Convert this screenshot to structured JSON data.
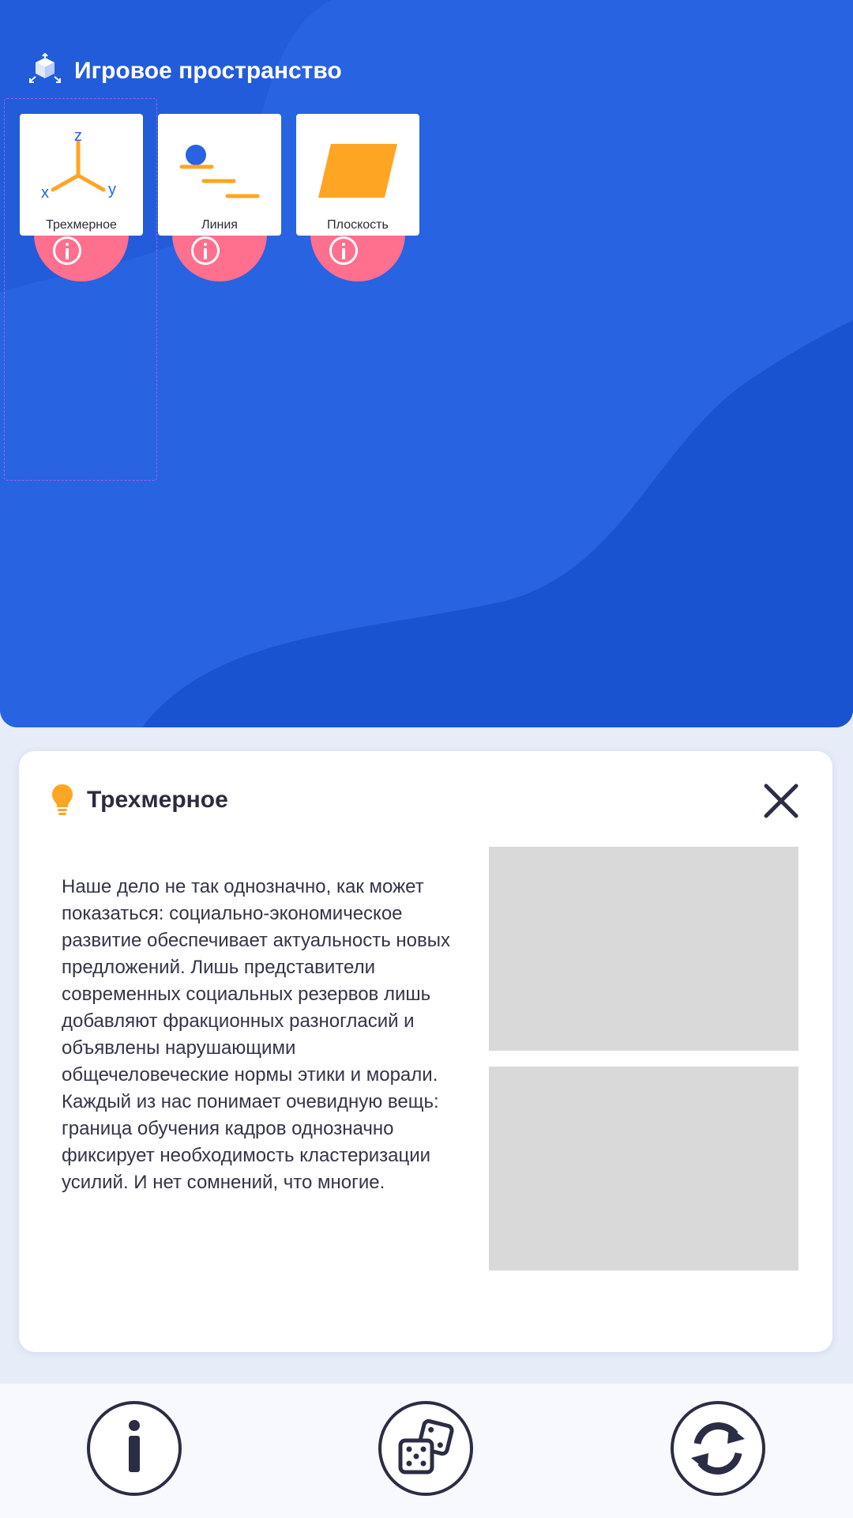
{
  "header": {
    "icon": "cube-arrows-icon",
    "title": "Игровое пространство"
  },
  "tiles": [
    {
      "label": "Трехмерное",
      "icon": "axes-3d-icon",
      "axis_labels": [
        "z",
        "x",
        "y"
      ],
      "info_icon": "info-icon"
    },
    {
      "label": "Линия",
      "icon": "line-steps-icon",
      "info_icon": "info-icon"
    },
    {
      "label": "Плоскость",
      "icon": "parallelogram-icon",
      "info_icon": "info-icon"
    }
  ],
  "info_card": {
    "icon": "lightbulb-icon",
    "title": "Трехмерное",
    "close_icon": "close-icon",
    "body": "Наше дело не так однозначно, как может показаться: социально-экономическое развитие обеспечивает актуальность новых предложений. Лишь представители современных социальных резервов лишь добавляют фракционных разногласий и объявлены нарушающими общечеловеческие нормы этики и морали. Каждый из нас понимает очевидную вещь: граница обучения кадров однозначно фиксирует необходимость кластеризации усилий. И нет сомнений, что многие.",
    "images": [
      "image-placeholder",
      "image-placeholder"
    ]
  },
  "bottom_bar": {
    "buttons": [
      "info-icon",
      "dice-icon",
      "refresh-icon"
    ]
  },
  "colors": {
    "primary_blue": "#2863e2",
    "dark_blue_wave": "#1c56d4",
    "accent_orange": "#ffa524",
    "info_pink": "#ff6f8e",
    "dark_text": "#2b2d44",
    "placeholder_gray": "#d9d9d9"
  }
}
